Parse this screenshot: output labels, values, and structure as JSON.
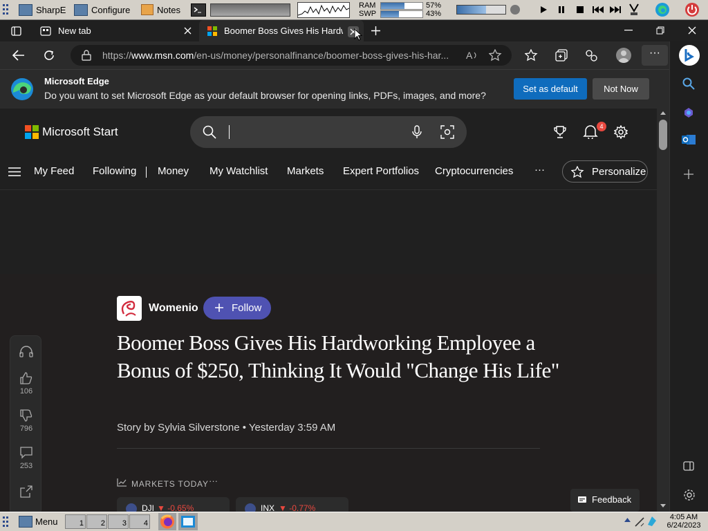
{
  "topbar": {
    "app1": "SharpE",
    "app2": "Configure",
    "app3": "Notes",
    "ram_label": "RAM",
    "swp_label": "SWP",
    "ram_pct": "57%",
    "swp_pct": "43%",
    "ram_fill": 0.57,
    "swp_fill": 0.43
  },
  "tabs": [
    {
      "title": "New tab"
    },
    {
      "title": "Boomer Boss Gives His Hardworl"
    }
  ],
  "address": {
    "url_prefix": "https://",
    "url_domain": "www.msn.com",
    "url_path": "/en-us/money/personalfinance/boomer-boss-gives-his-har..."
  },
  "infobar": {
    "title": "Microsoft Edge",
    "message": "Do you want to set Microsoft Edge as your default browser for opening links, PDFs, images, and more?",
    "primary": "Set as default",
    "secondary": "Not Now"
  },
  "msn": {
    "brand": "Microsoft Start",
    "notif_count": "4",
    "nav": [
      "My Feed",
      "Following",
      "Money",
      "My Watchlist",
      "Markets",
      "Expert Portfolios",
      "Cryptocurrencies"
    ],
    "more": "···",
    "personalize": "Personalize"
  },
  "article": {
    "publisher": "Womenio",
    "follow": "Follow",
    "headline": "Boomer Boss Gives His Hardworking Employee a Bonus of $250, Thinking It Would \"Change His Life\"",
    "byline": "Story by Sylvia Silverstone • Yesterday 3:59 AM",
    "markets_title": "MARKETS TODAY",
    "markets_more": "···",
    "tickers": [
      {
        "symbol": "DJI",
        "change": "▼ -0.65%"
      },
      {
        "symbol": "INX",
        "change": "▼ -0.77%"
      }
    ],
    "likes": "106",
    "dislikes": "796",
    "comments": "253",
    "feedback": "Feedback"
  },
  "taskbar": {
    "menu": "Menu",
    "workspaces": [
      "1",
      "2",
      "3",
      "4"
    ],
    "time": "4:05 AM",
    "date": "6/24/2023"
  },
  "colors": {
    "accent_blue": "#0f6cbd",
    "follow_blue": "#4f52b2",
    "down_red": "#e8483f"
  }
}
